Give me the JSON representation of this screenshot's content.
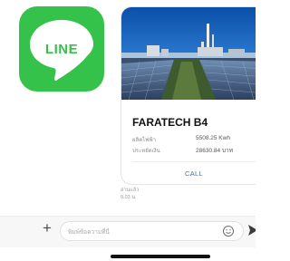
{
  "logo": {
    "text": "LINE",
    "color": "#35c24a"
  },
  "card": {
    "title": "FARATECH B4",
    "rows": [
      {
        "label": "ผลิตไฟฟ้า",
        "value": "5508.25 Kwh"
      },
      {
        "label": "ประหยัดเงิน",
        "value": "28630.84 บาท"
      }
    ],
    "action_label": "CALL"
  },
  "receipt": {
    "status": "อ่านแล้ว",
    "time": "9.03 น."
  },
  "input": {
    "placeholder": "พิมพ์ข้อความที่นี่",
    "plus_label": "+",
    "emoji_icon": "emoji-icon",
    "send_icon": "send-icon"
  },
  "colors": {
    "link": "#4a6fb0",
    "line_green": "#35c24a"
  }
}
